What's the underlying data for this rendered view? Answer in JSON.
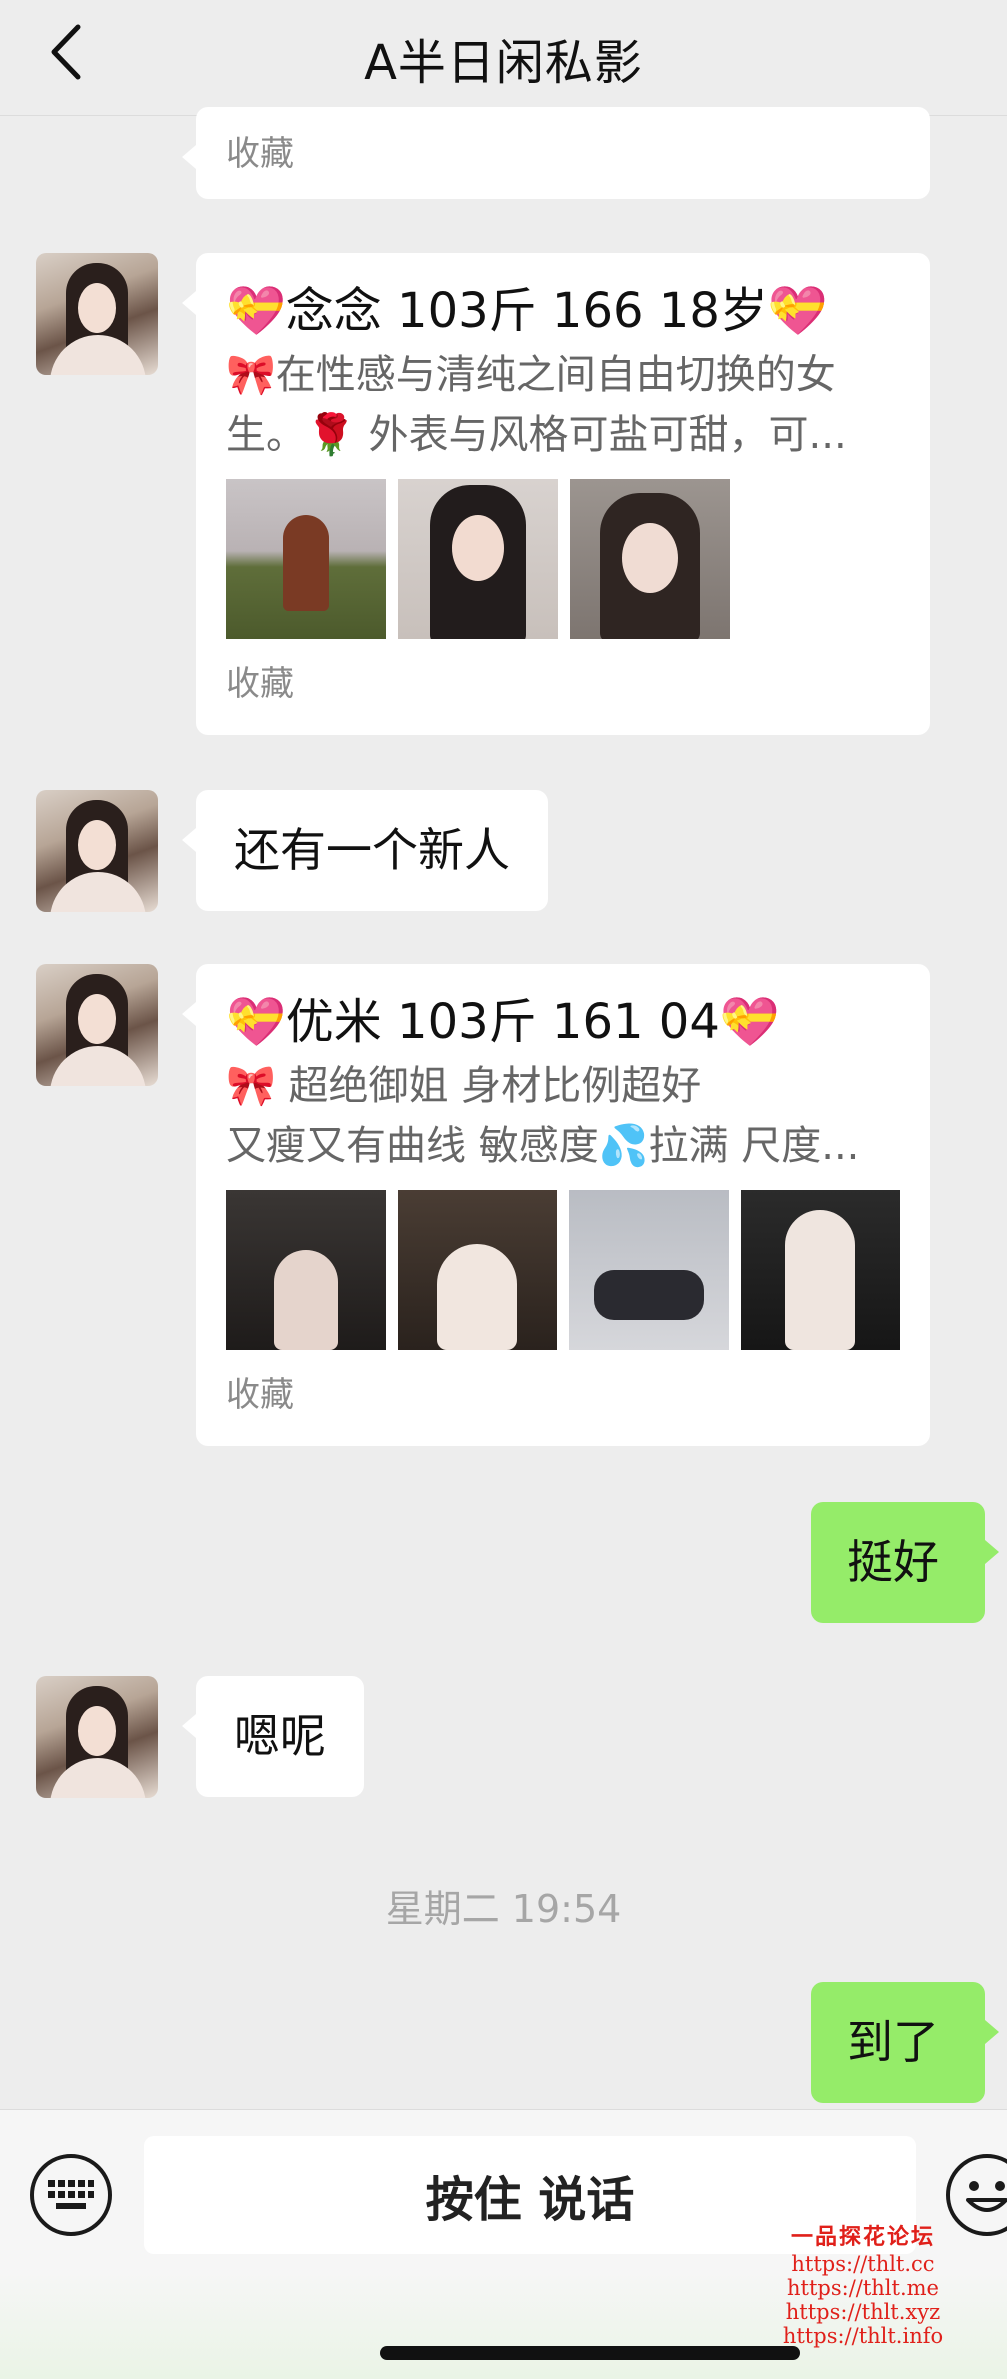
{
  "header": {
    "title": "A半日闲私影",
    "back_icon": "chevron-left-icon"
  },
  "messages": {
    "card0": {
      "footer": "收藏"
    },
    "card1": {
      "title": "💝念念 103斤 166  18岁💝",
      "desc_line1": "🎀在性感与清纯之间自由切换的女",
      "desc_line2": "生。🌹 外表与风格可盐可甜，可...",
      "footer": "收藏"
    },
    "text1": "还有一个新人",
    "card2": {
      "title": "💝优米 103斤 161  04💝",
      "desc_line1": "🎀 超绝御姐 身材比例超好",
      "desc_line2": "又瘦又有曲线 敏感度💦拉满 尺度...",
      "footer": "收藏"
    },
    "reply1": "挺好",
    "text2": "嗯呢",
    "timestamp": "星期二 19:54",
    "reply2": "到了"
  },
  "input_bar": {
    "hold_to_talk": "按住 说话",
    "keyboard_icon": "keyboard-icon",
    "emoji_icon": "emoji-icon"
  },
  "watermark": {
    "logo": "一品探花论坛",
    "urls": [
      "https://thlt.cc",
      "https://thlt.me",
      "https://thlt.xyz",
      "https://thlt.info"
    ]
  },
  "colors": {
    "background": "#ededed",
    "outgoing_bubble": "#95ec69",
    "incoming_bubble": "#ffffff",
    "watermark": "#e0201a"
  }
}
